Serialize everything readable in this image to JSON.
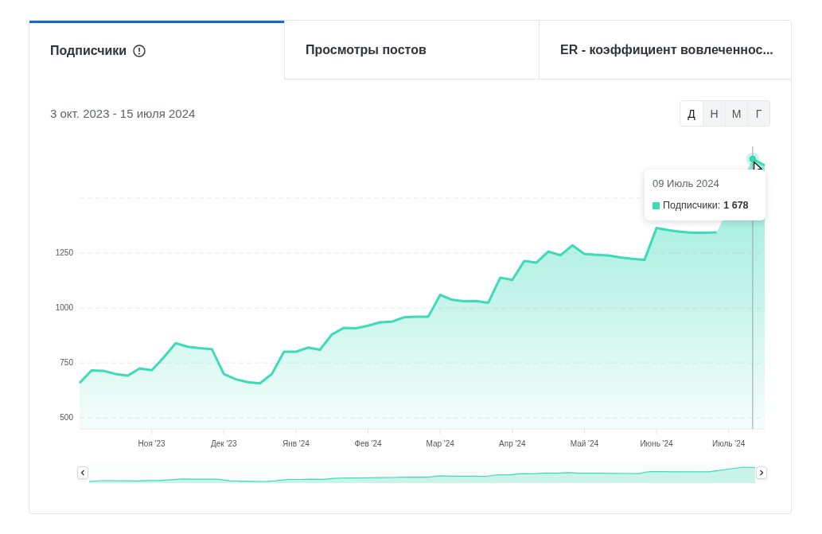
{
  "tabs": [
    {
      "label": "Подписчики",
      "info": true,
      "selected": true
    },
    {
      "label": "Просмотры постов",
      "info": false,
      "selected": false
    },
    {
      "label": "ER - коэффициент вовлеченнос...",
      "info": false,
      "selected": false
    }
  ],
  "date_range": "3 окт. 2023 - 15 июля 2024",
  "period_buttons": [
    {
      "label": "Д",
      "selected": true
    },
    {
      "label": "Н",
      "selected": false
    },
    {
      "label": "М",
      "selected": false
    },
    {
      "label": "Г",
      "selected": false
    }
  ],
  "chart": {
    "chart_data": {
      "type": "area",
      "categories": [
        null,
        null,
        null,
        null,
        null,
        null,
        "Ноя '23",
        null,
        null,
        null,
        null,
        null,
        "Дек '23",
        null,
        null,
        null,
        null,
        null,
        "Янв '24",
        null,
        null,
        null,
        null,
        null,
        "Фев '24",
        null,
        null,
        null,
        null,
        null,
        "Мар '24",
        null,
        null,
        null,
        null,
        null,
        "Апр '24",
        null,
        null,
        null,
        null,
        null,
        "Май '24",
        null,
        null,
        null,
        null,
        null,
        "Июнь '24",
        null,
        null,
        null,
        null,
        null,
        "Июль '24",
        null,
        null,
        null
      ],
      "series": [
        {
          "name": "Подписчики",
          "color": "#3ddbb8",
          "values": [
            659,
            716,
            714,
            700,
            692,
            725,
            717,
            775,
            840,
            824,
            817,
            813,
            700,
            676,
            663,
            657,
            700,
            801,
            801,
            820,
            810,
            880,
            910,
            908,
            920,
            935,
            938,
            958,
            960,
            960,
            1060,
            1037,
            1031,
            1032,
            1024,
            1138,
            1128,
            1214,
            1206,
            1257,
            1240,
            1285,
            1246,
            1242,
            1239,
            1230,
            1224,
            1219,
            1364,
            1354,
            1347,
            1342,
            1342,
            1344,
            null,
            null,
            1678,
            1649
          ]
        }
      ],
      "ylim": [
        450,
        1735
      ],
      "grid": true,
      "yticks": [
        500,
        750,
        1000,
        1250
      ]
    },
    "tooltip": {
      "date": "09 Июль 2024",
      "separator": ":",
      "value": "1 678"
    }
  }
}
